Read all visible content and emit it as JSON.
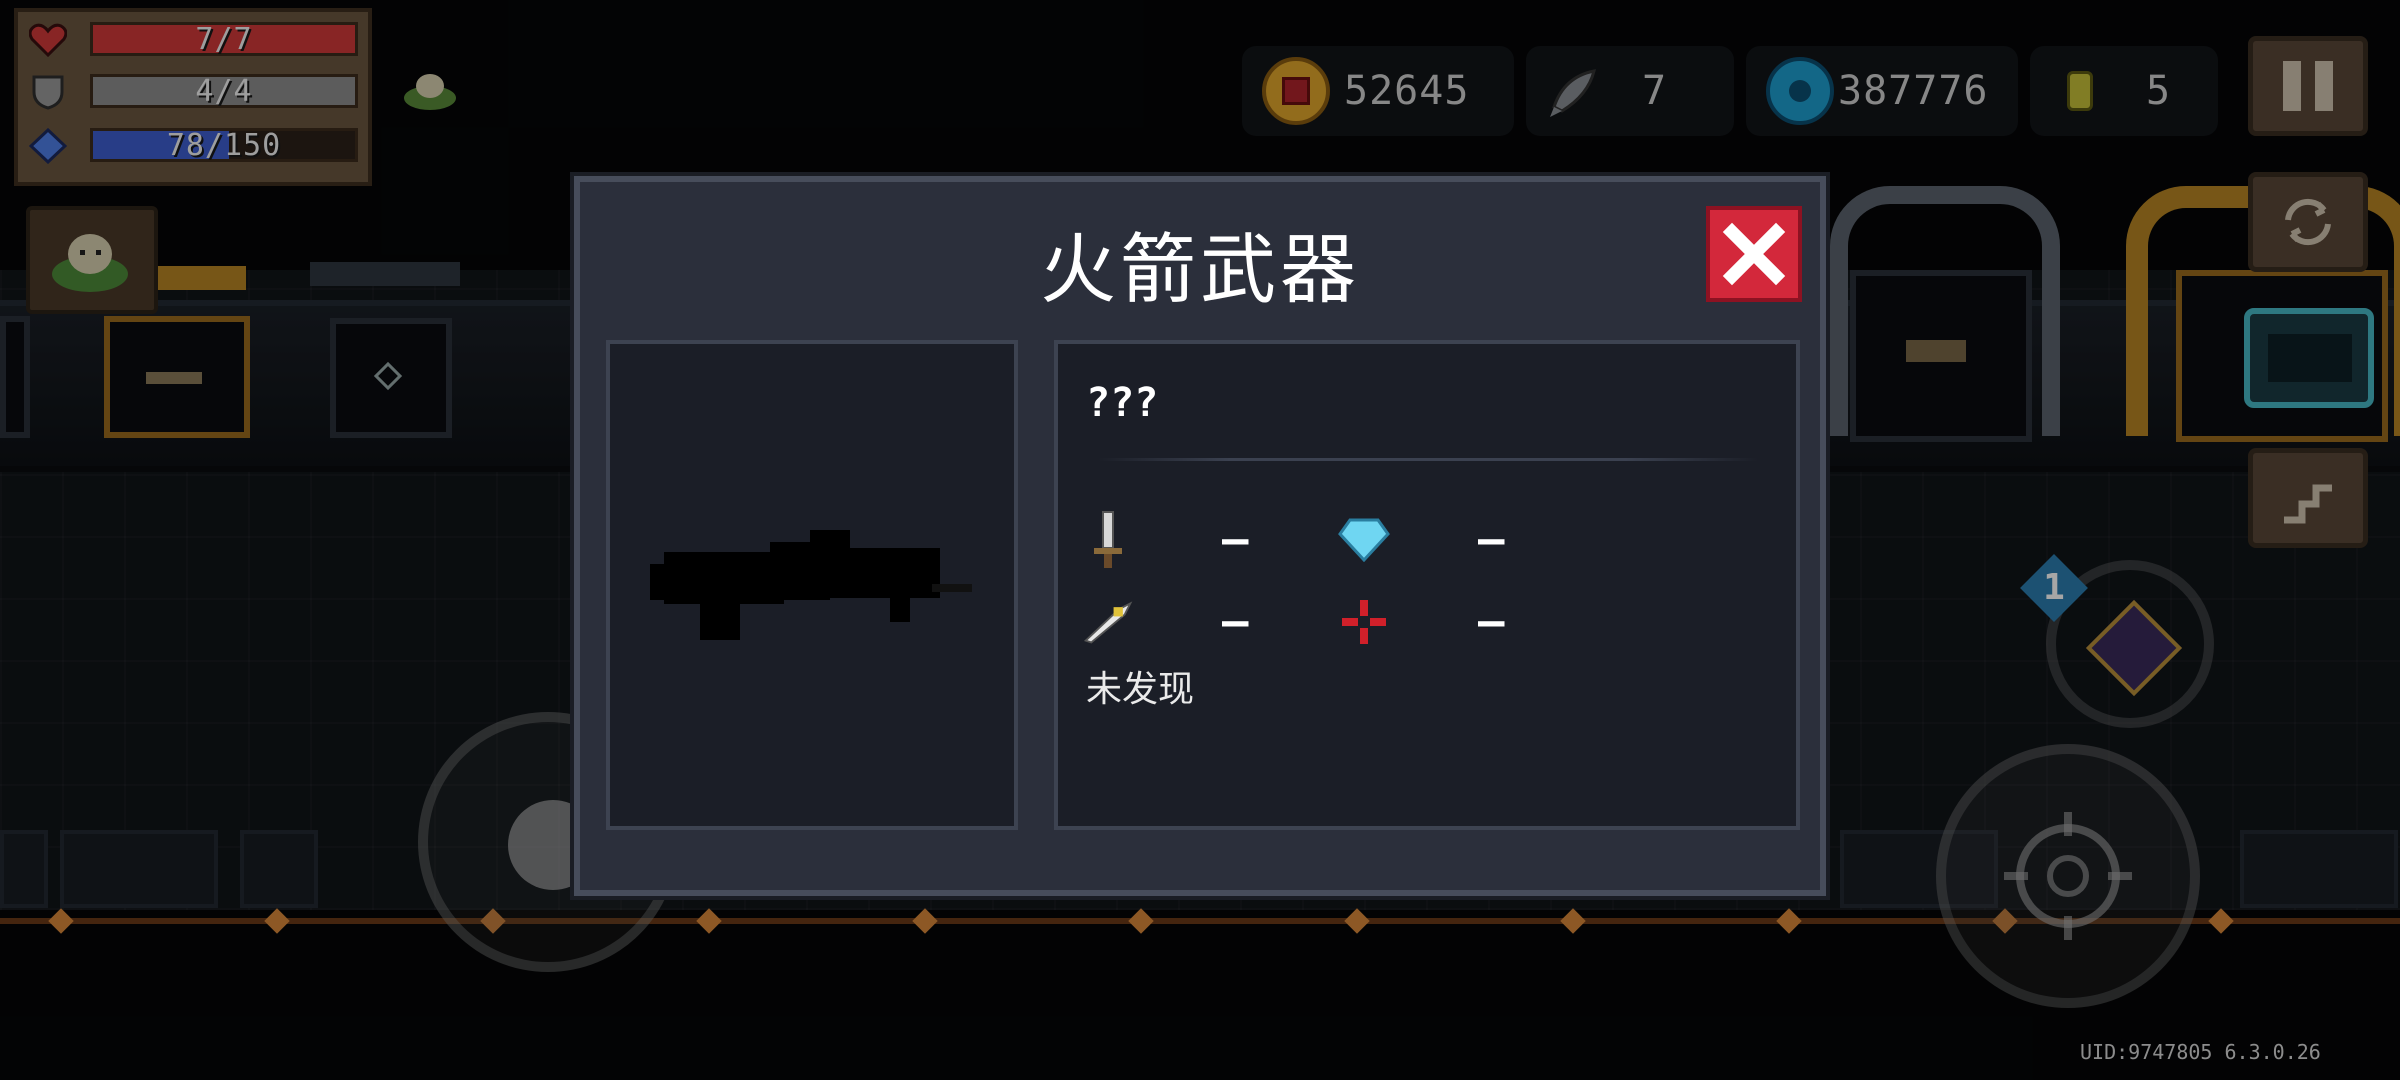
{
  "hud": {
    "health": {
      "current": 7,
      "max": 7,
      "label": "7/7",
      "color": "#d23a3a"
    },
    "armor": {
      "current": 4,
      "max": 4,
      "label": "4/4",
      "color": "#8e8e8e"
    },
    "energy": {
      "current": 78,
      "max": 150,
      "label": "78/150",
      "color": "#3e5fcf"
    }
  },
  "currencies": {
    "gold": {
      "icon": "gold-coin-icon",
      "value": "52645"
    },
    "fish": {
      "icon": "fish-icon",
      "value": "7"
    },
    "gems": {
      "icon": "gem-icon",
      "value": "387776"
    },
    "tokens": {
      "icon": "token-icon",
      "value": "5"
    }
  },
  "skill": {
    "charges": "1"
  },
  "footer": {
    "uid": "UID:9747805 6.3.0.26"
  },
  "modal": {
    "title": "火箭武器",
    "close_icon": "close-icon",
    "weapon": {
      "name": "???",
      "stats": {
        "damage": "–",
        "energy_cost": "–",
        "crit": "–",
        "accuracy": "–"
      },
      "status": "未发现"
    }
  },
  "colors": {
    "modal_bg": "#2b2f3b",
    "close_red": "#d3283b",
    "gold_accent": "#b78524"
  }
}
